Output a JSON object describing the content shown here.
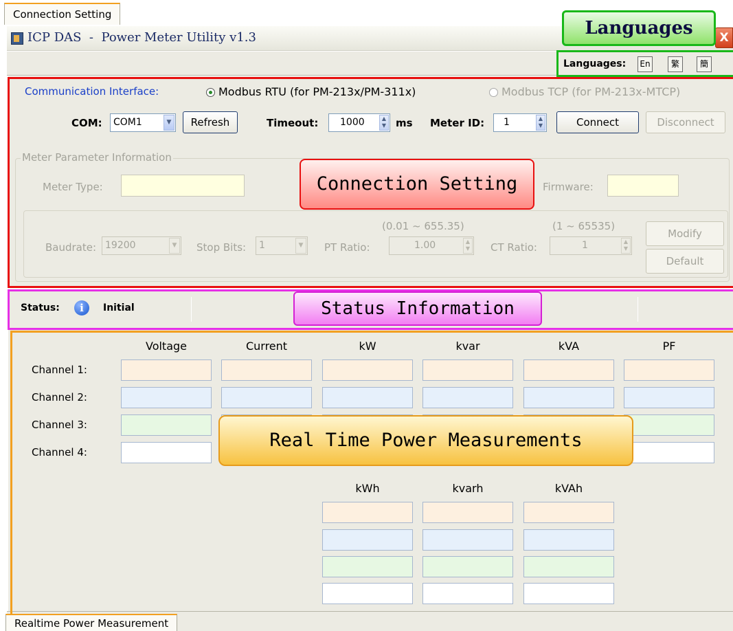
{
  "window": {
    "title": "ICP DAS  -  Power Meter Utility v1.3",
    "close_glyph": "X"
  },
  "tabs": {
    "connection": "Connection Setting",
    "realtime": "Realtime Power Measurement"
  },
  "languages": {
    "label": "Languages:",
    "buttons": [
      "En",
      "繁",
      "簡"
    ]
  },
  "connection": {
    "interface_label": "Communication Interface:",
    "rtu_option": "Modbus RTU (for PM-213x/PM-311x)",
    "tcp_option": "Modbus TCP (for PM-213x-MTCP)",
    "com_label": "COM:",
    "com_value": "COM1",
    "refresh": "Refresh",
    "timeout_label": "Timeout:",
    "timeout_value": "1000",
    "timeout_unit": "ms",
    "meter_id_label": "Meter ID:",
    "meter_id_value": "1",
    "connect": "Connect",
    "disconnect": "Disconnect"
  },
  "meter_info": {
    "group_title": "Meter Parameter Information",
    "meter_type_label": "Meter Type:",
    "firmware_label": "Firmware:",
    "baudrate_label": "Baudrate:",
    "baudrate_value": "19200",
    "stopbits_label": "Stop Bits:",
    "stopbits_value": "1",
    "pt_ratio_label": "PT Ratio:",
    "pt_ratio_range": "(0.01 ~ 655.35)",
    "pt_ratio_value": "1.00",
    "ct_ratio_label": "CT Ratio:",
    "ct_ratio_range": "(1 ~ 65535)",
    "ct_ratio_value": "1",
    "modify": "Modify",
    "default": "Default"
  },
  "status": {
    "label": "Status:",
    "value": "Initial",
    "icon": "info-icon"
  },
  "measurements": {
    "columns": [
      "Voltage",
      "Current",
      "kW",
      "kvar",
      "kVA",
      "PF"
    ],
    "rows": [
      "Channel 1:",
      "Channel 2:",
      "Channel 3:",
      "Channel 4:"
    ],
    "energy_columns": [
      "kWh",
      "kvarh",
      "kVAh"
    ]
  },
  "callouts": {
    "languages": "Languages",
    "connection": "Connection Setting",
    "status": "Status Information",
    "realtime": "Real Time Power Measurements"
  },
  "colors": {
    "languages_frame": "#19b819",
    "connection_frame": "#e81010",
    "status_frame": "#e630e6",
    "realtime_frame": "#f2a020",
    "tab_accent": "#f2a020",
    "link_blue": "#1a3fc8"
  }
}
